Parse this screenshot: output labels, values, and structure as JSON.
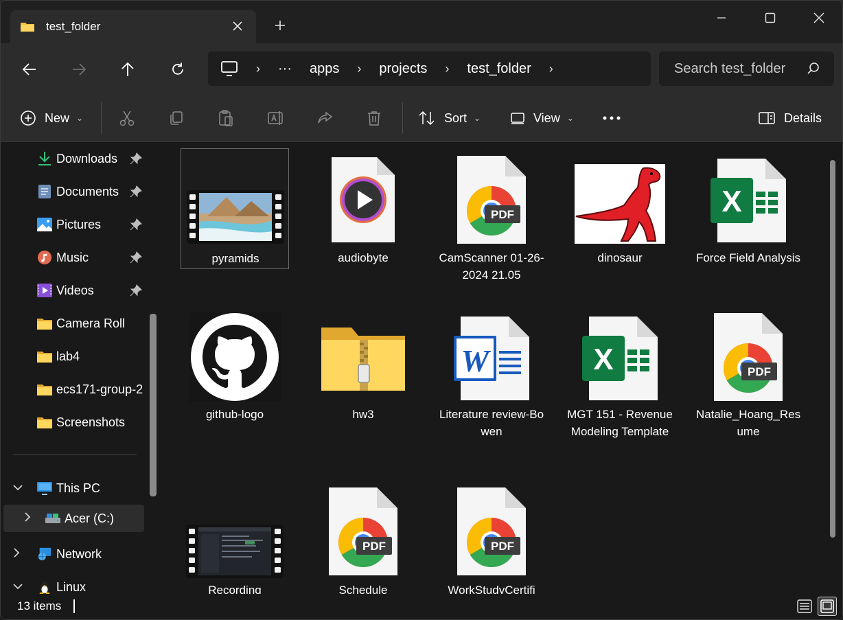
{
  "tab": {
    "label": "test_folder"
  },
  "window_controls": [
    "minimize",
    "maximize",
    "close"
  ],
  "breadcrumb": {
    "items": [
      "apps",
      "projects",
      "test_folder"
    ],
    "overflow": "···"
  },
  "search": {
    "placeholder": "Search test_folder"
  },
  "commands": {
    "new_label": "New",
    "sort_label": "Sort",
    "view_label": "View",
    "details_label": "Details"
  },
  "sidebar": {
    "items": [
      {
        "label": "Downloads",
        "icon": "download-icon",
        "pinned": true
      },
      {
        "label": "Documents",
        "icon": "documents-icon",
        "pinned": true
      },
      {
        "label": "Pictures",
        "icon": "pictures-icon",
        "pinned": true
      },
      {
        "label": "Music",
        "icon": "music-icon",
        "pinned": true
      },
      {
        "label": "Videos",
        "icon": "videos-icon",
        "pinned": true
      },
      {
        "label": "Camera Roll",
        "icon": "folder-icon"
      },
      {
        "label": "lab4",
        "icon": "folder-icon"
      },
      {
        "label": "ecs171-group-2",
        "icon": "folder-icon"
      },
      {
        "label": "Screenshots",
        "icon": "folder-icon"
      }
    ],
    "tree": [
      {
        "label": "This PC",
        "icon": "pc-icon",
        "expanded": true
      },
      {
        "label": "Acer (C:)",
        "icon": "drive-icon",
        "expanded": false
      },
      {
        "label": "Network",
        "icon": "network-icon",
        "expanded": false
      },
      {
        "label": "Linux",
        "icon": "linux-icon",
        "expanded": true
      }
    ]
  },
  "files": [
    {
      "name": "pyramids",
      "type": "video"
    },
    {
      "name": "audiobyte",
      "type": "audio"
    },
    {
      "name": "CamScanner 01-26-2024 21.05",
      "type": "pdf"
    },
    {
      "name": "dinosaur",
      "type": "image"
    },
    {
      "name": "Force Field Analysis",
      "type": "excel"
    },
    {
      "name": "github-logo",
      "type": "image"
    },
    {
      "name": "hw3",
      "type": "zip"
    },
    {
      "name": "Literature review-Bowen",
      "type": "word"
    },
    {
      "name": "MGT 151 - Revenue Modeling Template",
      "type": "excel"
    },
    {
      "name": "Natalie_Hoang_Resume",
      "type": "pdf"
    },
    {
      "name": "Recording",
      "type": "video"
    },
    {
      "name": "Schedule",
      "type": "pdf"
    },
    {
      "name": "WorkStudyCertifi",
      "type": "pdf"
    }
  ],
  "status": {
    "item_count": "13 items"
  },
  "colors": {
    "accent": "#0078d4",
    "folder": "#f5c542",
    "excel": "#107c41",
    "word": "#185abd"
  }
}
